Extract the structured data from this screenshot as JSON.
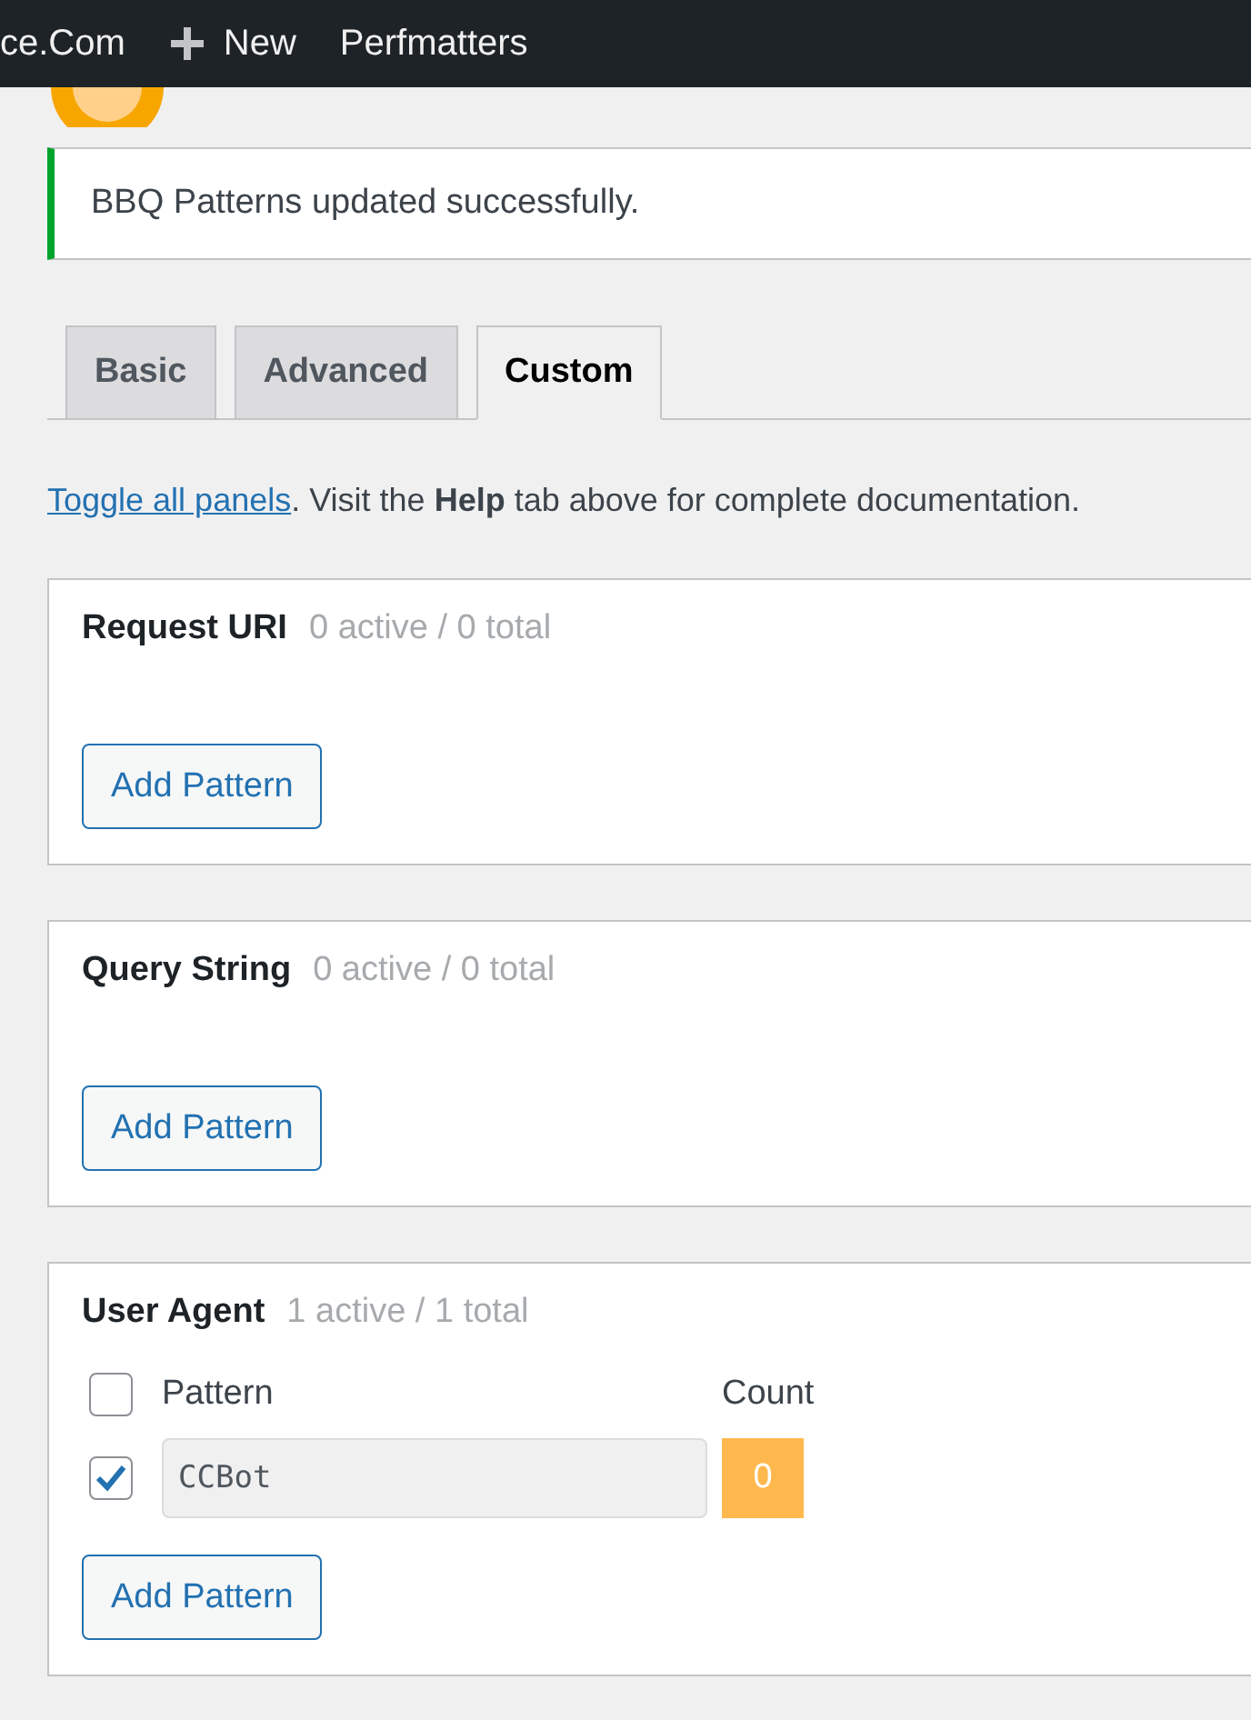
{
  "admin_bar": {
    "items": [
      {
        "kind": "text",
        "label": "ce.Com"
      },
      {
        "kind": "new",
        "label": "New"
      },
      {
        "kind": "text",
        "label": "Perfmatters"
      }
    ]
  },
  "notice": {
    "message": "BBQ Patterns updated successfully."
  },
  "tabs": [
    {
      "label": "Basic",
      "selected": false
    },
    {
      "label": "Advanced",
      "selected": false
    },
    {
      "label": "Custom",
      "selected": true
    }
  ],
  "intro": {
    "link": "Toggle all panels",
    "text": ". Visit the **Help** tab above for complete documentation."
  },
  "panels": [
    {
      "title": "Request URI",
      "summary": "0 active / 0 total",
      "button": "Add Pattern"
    },
    {
      "title": "Query String",
      "summary": "0 active / 0 total",
      "button": "Add Pattern"
    },
    {
      "title": "User Agent",
      "summary": "1 active / 1 total",
      "table": {
        "select_all": {
          "checked": false
        },
        "columns": [
          "Pattern",
          "Count"
        ],
        "rows": [
          {
            "checked": true,
            "pattern": "CCBot",
            "count": "0"
          }
        ]
      },
      "button": "Add Pattern"
    }
  ]
}
